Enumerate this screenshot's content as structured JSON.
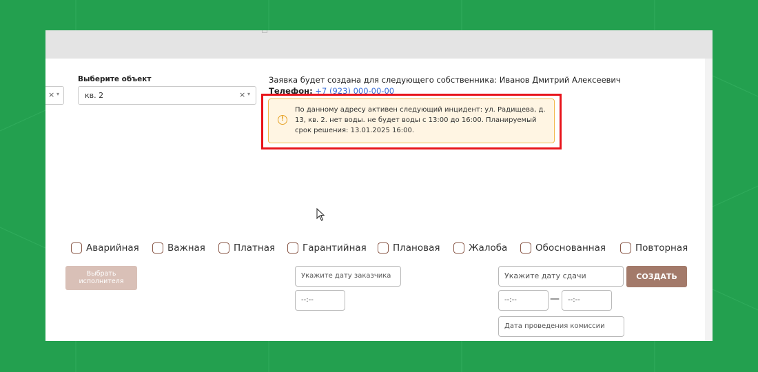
{
  "object_select": {
    "label": "Выберите объект",
    "value": "кв. 2",
    "clear": "×",
    "arrow": "▾"
  },
  "left_select": {
    "clear": "×",
    "arrow": "▾"
  },
  "owner": {
    "line": "Заявка будет создана для следующего собственника: Иванов Дмитрий Алексеевич",
    "phone_label": "Телефон:",
    "phone_value": "+7 (923) 000-00-00"
  },
  "incident_alert": {
    "icon": "!",
    "text": "По данному адресу активен следующий инцидент: ул. Радищева, д. 13, кв. 2. нет воды. не будет воды с 13:00 до 16:00. Планируемый срок решения: 13.01.2025 16:00."
  },
  "flags": [
    {
      "label": "Аварийная"
    },
    {
      "label": "Важная"
    },
    {
      "label": "Платная"
    },
    {
      "label": "Гарантийная"
    },
    {
      "label": "Плановая"
    },
    {
      "label": "Жалоба"
    },
    {
      "label": "Обоснованная"
    },
    {
      "label": "Повторная"
    }
  ],
  "actions": {
    "choose_executor": "Выбрать исполнителя",
    "create": "СОЗДАТЬ"
  },
  "fields": {
    "customer_date_placeholder": "Укажите дату заказчика",
    "customer_time_placeholder": "--:--",
    "due_date_placeholder": "Укажите дату сдачи",
    "time_from_placeholder": "--:--",
    "time_to_placeholder": "--:--",
    "range_dash": "—",
    "commission_date_placeholder": "Дата проведения комиссии"
  },
  "colors": {
    "background": "#23a04f",
    "alert_bg": "#fff5e3",
    "alert_border": "#f2b84b",
    "highlight": "#e8141b",
    "create_button": "#a37a6a",
    "executor_button_disabled": "#d9c0b7",
    "checkbox_border": "#8a5a4a"
  }
}
